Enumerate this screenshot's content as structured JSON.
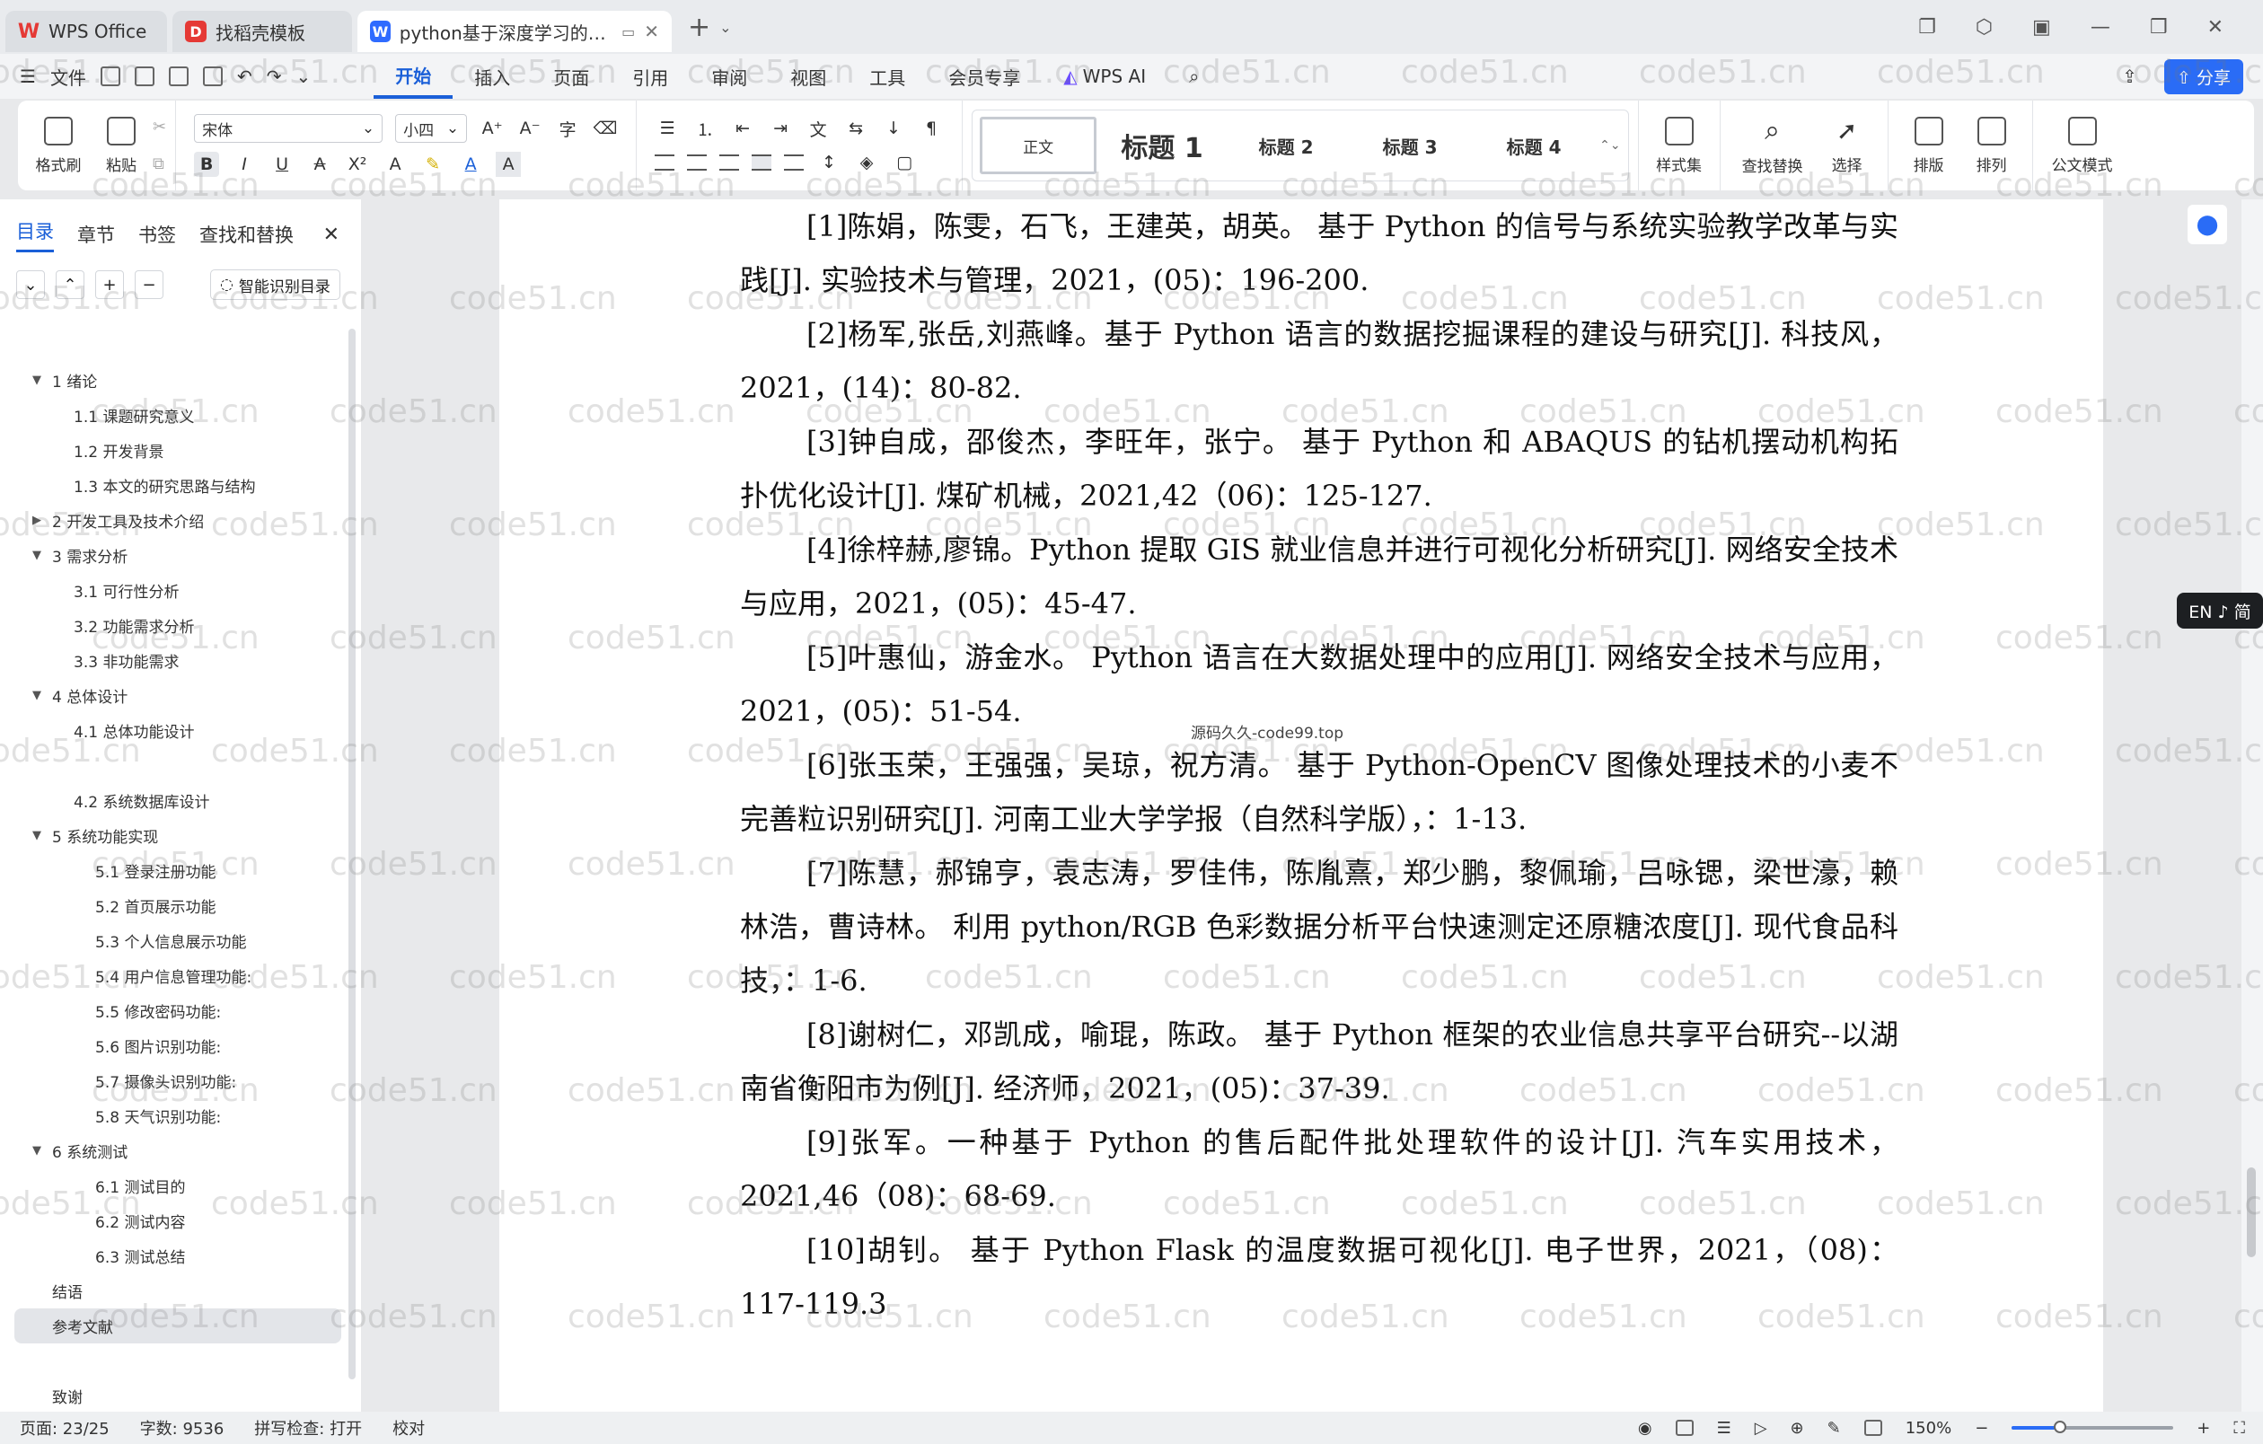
{
  "tabs": [
    {
      "label": "WPS Office",
      "logo": "W"
    },
    {
      "label": "找稻壳模板",
      "logo": "D"
    },
    {
      "label": "python基于深度学习的交通",
      "logo": "W"
    }
  ],
  "menu": {
    "file": "文件",
    "items": [
      "开始",
      "插入",
      "页面",
      "引用",
      "审阅",
      "视图",
      "工具",
      "会员专享"
    ],
    "active": "开始",
    "wps_ai": "WPS AI",
    "share": "分享"
  },
  "ribbon": {
    "format_painter": "格式刷",
    "paste": "粘贴",
    "font_name": "宋体",
    "font_size": "小四",
    "styles": [
      "正文",
      "标题 1",
      "标题 2",
      "标题 3",
      "标题 4"
    ],
    "style_set": "样式集",
    "find_replace": "查找替换",
    "select": "选择",
    "layout": "排版",
    "arrange": "排列",
    "official_mode": "公文模式"
  },
  "nav": {
    "tabs": [
      "目录",
      "章节",
      "书签",
      "查找和替换"
    ],
    "smart_toc": "智能识别目录",
    "toc": [
      {
        "label": "1  绪论",
        "level": 1,
        "caret": "▼"
      },
      {
        "label": "1.1 课题研究意义",
        "level": 2
      },
      {
        "label": "1.2 开发背景",
        "level": 2
      },
      {
        "label": "1.3 本文的研究思路与结构",
        "level": 2
      },
      {
        "label": "2  开发工具及技术介绍",
        "level": 1,
        "caret": "▶"
      },
      {
        "label": "3  需求分析",
        "level": 1,
        "caret": "▼"
      },
      {
        "label": "3.1  可行性分析",
        "level": 2
      },
      {
        "label": "3.2  功能需求分析",
        "level": 2
      },
      {
        "label": "3.3  非功能需求",
        "level": 2
      },
      {
        "label": "4  总体设计",
        "level": 1,
        "caret": "▼"
      },
      {
        "label": "4.1  总体功能设计",
        "level": 2
      },
      {
        "label": "",
        "level": 2
      },
      {
        "label": "4.2  系统数据库设计",
        "level": 2
      },
      {
        "label": "5  系统功能实现",
        "level": 1,
        "caret": "▼"
      },
      {
        "label": "5.1  登录注册功能",
        "level": 3
      },
      {
        "label": "5.2  首页展示功能",
        "level": 3
      },
      {
        "label": "5.3  个人信息展示功能",
        "level": 3
      },
      {
        "label": "5.4  用户信息管理功能:",
        "level": 3
      },
      {
        "label": "5.5  修改密码功能:",
        "level": 3
      },
      {
        "label": "5.6 图片识别功能:",
        "level": 3
      },
      {
        "label": "5.7 摄像头识别功能:",
        "level": 3
      },
      {
        "label": "5.8 天气识别功能:",
        "level": 3
      },
      {
        "label": "6  系统测试",
        "level": 1,
        "caret": "▼"
      },
      {
        "label": "6.1  测试目的",
        "level": 3
      },
      {
        "label": "6.2  测试内容",
        "level": 3
      },
      {
        "label": "6.3  测试总结",
        "level": 3
      },
      {
        "label": "结语",
        "level": 0
      },
      {
        "label": "参考文献",
        "level": 0,
        "selected": true
      },
      {
        "label": "",
        "level": 0
      },
      {
        "label": "致谢",
        "level": 0
      }
    ]
  },
  "document": {
    "references": [
      "[1]陈娟，陈雯，石飞，王建英，胡英。 基于 Python 的信号与系统实验教学改革与实践[J]. 实验技术与管理，2021，(05)：196-200.",
      "[2]杨军,张岳,刘燕峰。基于 Python 语言的数据挖掘课程的建设与研究[J]. 科技风，2021，(14)：80-82.",
      "[3]钟自成，邵俊杰，李旺年，张宁。 基于 Python 和 ABAQUS 的钻机摆动机构拓扑优化设计[J]. 煤矿机械，2021,42（06)：125-127.",
      "[4]徐梓赫,廖锦。Python 提取 GIS 就业信息并进行可视化分析研究[J]. 网络安全技术与应用，2021，(05)：45-47.",
      "[5]叶惠仙，游金水。 Python 语言在大数据处理中的应用[J]. 网络安全技术与应用，2021，(05)：51-54.",
      "[6]张玉荣，王强强，吴琼，祝方清。 基于 Python-OpenCV 图像处理技术的小麦不完善粒识别研究[J]. 河南工业大学学报（自然科学版），：1-13.",
      "[7]陈慧，郝锦亨，袁志涛，罗佳伟，陈胤熹，郑少鹏，黎佩瑜，吕咏锶，梁世濠，赖林浩，曹诗林。 利用 python/RGB 色彩数据分析平台快速测定还原糖浓度[J]. 现代食品科技，：1-6.",
      "[8]谢树仁，邓凯成，喻琨，陈政。 基于 Python 框架的农业信息共享平台研究--以湖南省衡阳市为例[J]. 经济师，2021，(05)：37-39.",
      "[9]张军。一种基于 Python 的售后配件批处理软件的设计[J]. 汽车实用技术，2021,46（08)：68-69.",
      "[10]胡钊。 基于 Python Flask 的温度数据可视化[J]. 电子世界，2021，（08)：117-119.3"
    ],
    "source_note": "源码久久-code99.top",
    "watermark": "code51.cn"
  },
  "side": {
    "ime": "EN ♪ 简"
  },
  "status": {
    "page": "页面: 23/25",
    "words": "字数: 9536",
    "spell": "拼写检查: 打开",
    "proof": "校对",
    "zoom": "150%",
    "zoom_fraction": 0.3
  },
  "colors": {
    "accent": "#1a5fd8",
    "share": "#2a6cf6"
  }
}
